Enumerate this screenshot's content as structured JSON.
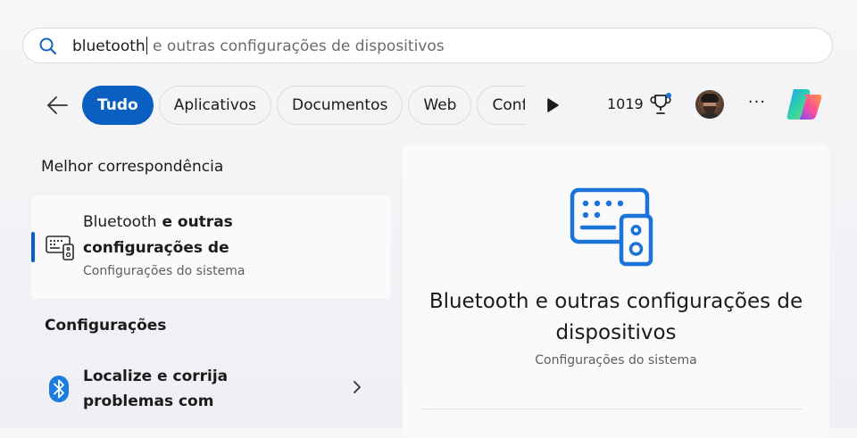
{
  "search": {
    "typed": "bluetooth",
    "suggestion": " e outras configurações de dispositivos"
  },
  "tabs": [
    {
      "label": "Tudo",
      "active": true
    },
    {
      "label": "Aplicativos",
      "active": false
    },
    {
      "label": "Documentos",
      "active": false
    },
    {
      "label": "Web",
      "active": false
    },
    {
      "label": "Configurações",
      "active": false
    }
  ],
  "header": {
    "points": "1019"
  },
  "best_match": {
    "section_label": "Melhor correspondência",
    "title_prefix": "Bluetooth",
    "title_rest": " e outras configurações de",
    "subtitle": "Configurações do sistema",
    "icon": "devices-settings-icon"
  },
  "settings_section": {
    "label": "Configurações",
    "items": [
      {
        "title": "Localize e corrija problemas com",
        "icon": "bluetooth-icon"
      }
    ]
  },
  "preview": {
    "title": "Bluetooth e outras configurações de dispositivos",
    "subtitle": "Configurações do sistema",
    "icon": "devices-settings-icon"
  },
  "colors": {
    "accent": "#0a5fc0",
    "icon_blue": "#1a73d9",
    "bluetooth_blue": "#1c7ce0"
  }
}
